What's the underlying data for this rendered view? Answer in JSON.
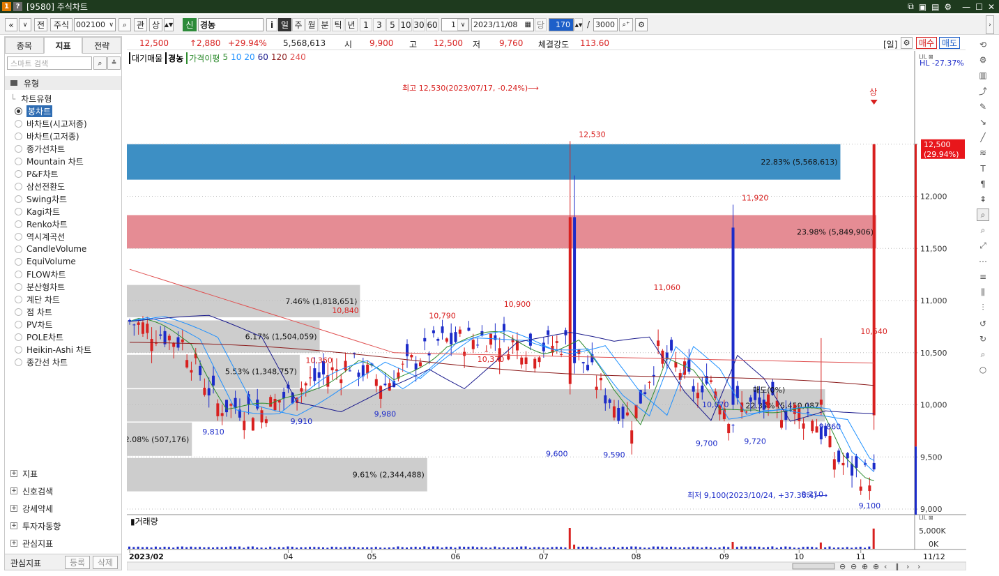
{
  "window": {
    "badges": [
      "1",
      "?"
    ],
    "title": "[9580] 주식차트",
    "controls": [
      "⧉",
      "▣",
      "▤",
      "⚙",
      "—",
      "☐",
      "✕"
    ]
  },
  "toolbar": {
    "nav_prev": "«",
    "nav_next": "»",
    "prev_label": "전",
    "market_label": "주식",
    "code_value": "002100",
    "gwan_label": "관",
    "sang_label": "상",
    "shin_label": "신",
    "stock_name": "경농",
    "info_label": "i",
    "periods": [
      "일",
      "주",
      "월",
      "분",
      "틱",
      "년"
    ],
    "active_period": "일",
    "intervals": [
      "1",
      "3",
      "5",
      "10",
      "30",
      "60"
    ],
    "count_value": "1",
    "date_value": "2023/11/08",
    "dang_label": "당",
    "display_count": "170",
    "slash": "/",
    "total_count": "3000"
  },
  "sidebar": {
    "tabs": [
      "종목",
      "지표",
      "전략"
    ],
    "active_tab": "지표",
    "search_placeholder": "스마트 검색",
    "section_label": "유형",
    "tree_root": "차트유형",
    "chart_types": [
      "봉차트",
      "바차트(시고저종)",
      "바차트(고저종)",
      "종가선차트",
      "Mountain 차트",
      "P&F차트",
      "삼선전환도",
      "Swing차트",
      "Kagi차트",
      "Renko차트",
      "역시계곡선",
      "CandleVolume",
      "EquiVolume",
      "FLOW차트",
      "분산형차트",
      "계단 차트",
      "점 차트",
      "PV차트",
      "POLE차트",
      "Heikin-Ashi 차트",
      "종간선 차트"
    ],
    "selected_type": "봉차트",
    "groups": [
      "지표",
      "신호검색",
      "강세약세",
      "투자자동향",
      "관심지표"
    ],
    "bottom_label": "관심지표",
    "register_label": "등록",
    "delete_label": "삭제"
  },
  "quote": {
    "price": "12,500",
    "change": "↑2,880",
    "change_pct": "+29.94%",
    "volume": "5,568,613",
    "open_label": "시",
    "open": "9,900",
    "high_label": "고",
    "high": "12,500",
    "low_label": "저",
    "low": "9,760",
    "strength_label": "체결강도",
    "strength": "113.60",
    "period_tag": "[일]",
    "buy_label": "매수",
    "sell_label": "매도"
  },
  "legend": {
    "items": [
      "대기매물",
      "경농",
      "가격이평",
      "5",
      "10",
      "20",
      "60",
      "120",
      "240"
    ],
    "colors": [
      "#000000",
      "#000000",
      "#2e8b2e",
      "#2e8b2e",
      "#1e90ff",
      "#1e90ff",
      "#1a1a8c",
      "#8b1a1a",
      "#e05050"
    ]
  },
  "chart_labels": {
    "hl_label": "HL -27.37%",
    "price_tag": "12,500",
    "price_tag_pct": "(29.94%)",
    "high_note": "최고 12,530(2023/07/17, -0.24%)⟶",
    "low_note": "최저 9,100(2023/10/24, +37.36%)⟶",
    "limit_up": "상",
    "volume_title": "거래량",
    "vol_axis": [
      "5,000K",
      "0K"
    ],
    "date_right": "11/12",
    "x_year": "2023/02",
    "peak_labels": [
      "12,530",
      "11,920",
      "11,060",
      "10,900",
      "10,840",
      "10,790",
      "10,640",
      "10,360",
      "10,370",
      "10,070",
      "9,860",
      "9,810",
      "9,910",
      "9,980",
      "9,600",
      "9,590",
      "9,700",
      "9,720",
      "9,210",
      "9,100"
    ],
    "sell_note": "매도(0%)"
  },
  "chart_data": {
    "type": "candlestick",
    "yaxis": {
      "ticks": [
        9000,
        9500,
        10000,
        10500,
        11000,
        11500,
        12000,
        12500
      ],
      "ylim": [
        8900,
        12900
      ]
    },
    "xaxis": {
      "ticks": [
        "2023/02",
        "04",
        "05",
        "06",
        "07",
        "08",
        "09",
        "10",
        "11"
      ]
    },
    "supply_zones": [
      {
        "label": "22.83% (5,568,613)",
        "pct": 22.83,
        "volume": 5568613,
        "price_low": 12160,
        "price_high": 12500,
        "color": "#3d8fc4"
      },
      {
        "label": "23.98% (5,849,906)",
        "pct": 23.98,
        "volume": 5849906,
        "price_low": 11500,
        "price_high": 11820,
        "color": "#e58c94"
      },
      {
        "label": "7.46% (1,818,651)",
        "pct": 7.46,
        "volume": 1818651,
        "price_low": 10840,
        "price_high": 11150,
        "color": "#c8c8c8"
      },
      {
        "label": "6.17% (1,504,059)",
        "pct": 6.17,
        "volume": 1504059,
        "price_low": 10500,
        "price_high": 10810,
        "color": "#c8c8c8"
      },
      {
        "label": "5.53% (1,348,757)",
        "pct": 5.53,
        "volume": 1348757,
        "price_low": 10160,
        "price_high": 10480,
        "color": "#c8c8c8"
      },
      {
        "label": "22.34% (5,450,087)",
        "pct": 22.34,
        "volume": 5450087,
        "price_low": 9840,
        "price_high": 10150,
        "color": "#c8c8c8"
      },
      {
        "label": "2.08% (507,176)",
        "pct": 2.08,
        "volume": 507176,
        "price_low": 9510,
        "price_high": 9830,
        "color": "#c8c8c8"
      },
      {
        "label": "9.61% (2,344,488)",
        "pct": 9.61,
        "volume": 2344488,
        "price_low": 9170,
        "price_high": 9490,
        "color": "#c8c8c8"
      }
    ],
    "annotated_points": [
      {
        "label": "12,530",
        "date": "2023-07-17",
        "value": 12530
      },
      {
        "label": "11,920",
        "date": "2023-09-11",
        "value": 11920
      },
      {
        "label": "11,060",
        "date": "2023-08-10",
        "value": 11060
      },
      {
        "label": "10,900",
        "date": "2023-06-22",
        "value": 10900
      },
      {
        "label": "10,840",
        "date": "2023-04-20",
        "value": 10840
      },
      {
        "label": "10,790",
        "date": "2023-05-25",
        "value": 10790
      },
      {
        "label": "10,640",
        "date": "2023-10-31",
        "value": 10640
      },
      {
        "label": "10,360",
        "date": "2023-04-10",
        "value": 10360
      },
      {
        "label": "10,370",
        "date": "2023-06-12",
        "value": 10370
      },
      {
        "label": "10,070",
        "date": "2023-08-28",
        "value": 10070
      },
      {
        "label": "9,860",
        "date": "2023-10-10",
        "value": 9860
      },
      {
        "label": "9,810",
        "date": "2023-03-06",
        "value": 9810
      },
      {
        "label": "9,910",
        "date": "2023-04-04",
        "value": 9910
      },
      {
        "label": "9,980",
        "date": "2023-05-04",
        "value": 9980
      },
      {
        "label": "9,600",
        "date": "2023-07-04",
        "value": 9600
      },
      {
        "label": "9,590",
        "date": "2023-07-25",
        "value": 9590
      },
      {
        "label": "9,700",
        "date": "2023-08-24",
        "value": 9700
      },
      {
        "label": "9,720",
        "date": "2023-09-11",
        "value": 9720
      },
      {
        "label": "9,210",
        "date": "2023-10-05",
        "value": 9210
      },
      {
        "label": "9,100",
        "date": "2023-10-24",
        "value": 9100
      }
    ],
    "last_candle": {
      "date": "2023-11-08",
      "open": 9900,
      "high": 12500,
      "low": 9760,
      "close": 12500,
      "volume": 5568613
    }
  }
}
